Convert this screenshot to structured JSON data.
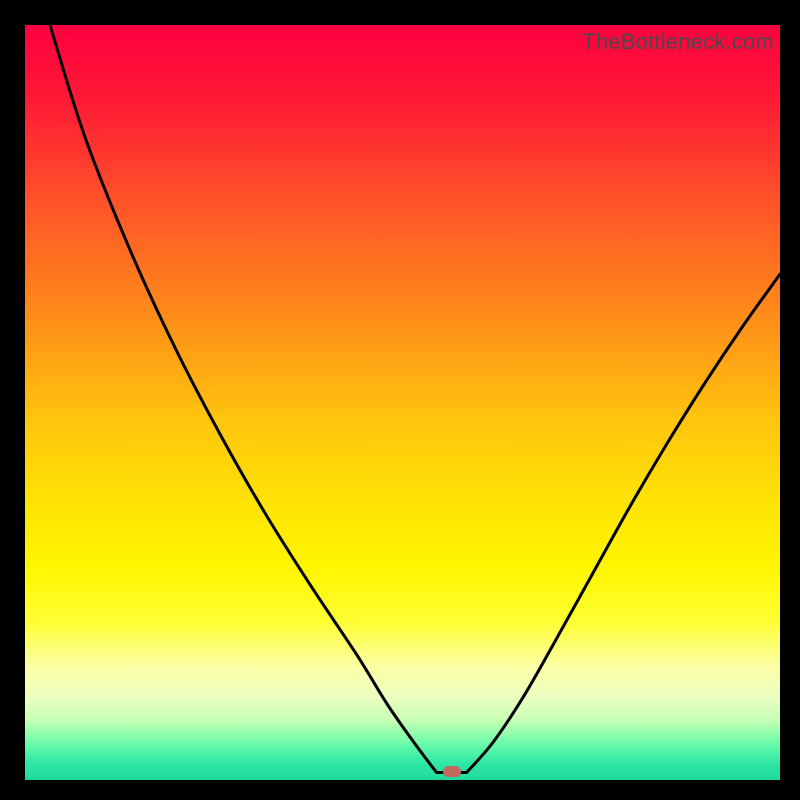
{
  "watermark": "TheBottleneck.com",
  "colors": {
    "frame_bg": "#000000",
    "marker": "#c36a5d",
    "curve": "#000000"
  },
  "chart_data": {
    "type": "line",
    "title": "",
    "xlabel": "",
    "ylabel": "",
    "xlim": [
      0,
      100
    ],
    "ylim": [
      0,
      100
    ],
    "series": [
      {
        "name": "left-branch",
        "x": [
          3.3,
          8,
          14,
          20,
          26,
          32,
          38,
          44,
          48,
          51.5,
          54.5
        ],
        "y": [
          100,
          85,
          70,
          57,
          45.5,
          35,
          25.5,
          16.5,
          10,
          5,
          1
        ]
      },
      {
        "name": "right-branch",
        "x": [
          58.5,
          62,
          66,
          70,
          75,
          80,
          85,
          90,
          95,
          100
        ],
        "y": [
          1,
          5,
          11,
          18,
          27,
          36,
          44.5,
          52.5,
          60,
          67
        ]
      }
    ],
    "flat_segment": {
      "x": [
        54.5,
        58.5
      ],
      "y": 1
    },
    "marker": {
      "x": 56.5,
      "y": 1
    },
    "gradient_stops": [
      {
        "pct": 0,
        "color": "#ff0040"
      },
      {
        "pct": 50,
        "color": "#ffd000"
      },
      {
        "pct": 80,
        "color": "#ffff60"
      },
      {
        "pct": 100,
        "color": "#1fd99c"
      }
    ]
  }
}
